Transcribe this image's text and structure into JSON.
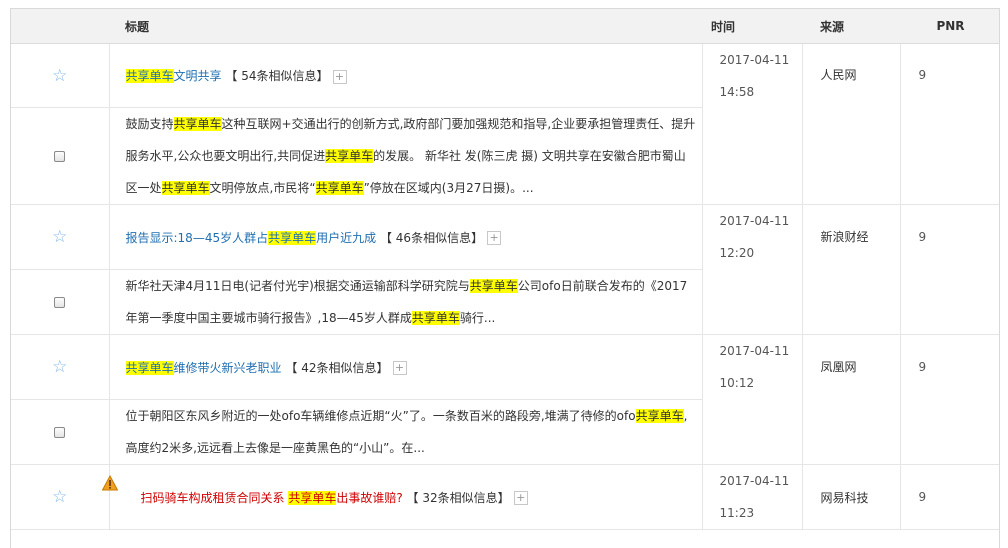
{
  "header": {
    "col_title": "标题",
    "col_time": "时间",
    "col_source": "来源",
    "col_pnr": "PNR"
  },
  "similar_open": "【",
  "similar_close": "】",
  "plus_glyph": "+",
  "star_glyph": "☆",
  "rows": [
    {
      "title_parts": [
        "共享单车",
        "文明共享"
      ],
      "similar": "54条相似信息",
      "date": "2017-04-11",
      "time": "14:58",
      "source": "人民网",
      "pnr": "9",
      "snippet_parts": [
        "鼓励支持",
        "共享单车",
        "这种互联网+交通出行的创新方式,政府部门要加强规范和指导,企业要承担管理责任、提升服务水平,公众也要文明出行,共同促进",
        "共享单车",
        "的发展。 新华社 发(陈三虎 摄) 文明共享在安徽合肥市蜀山区一处",
        "共享单车",
        "文明停放点,市民将“",
        "共享单车",
        "”停放在区域内(3月27日摄)。..."
      ]
    },
    {
      "title_parts": [
        "报告显示:18—45岁人群占",
        "共享单车",
        "用户近九成"
      ],
      "similar": "46条相似信息",
      "date": "2017-04-11",
      "time": "12:20",
      "source": "新浪财经",
      "pnr": "9",
      "snippet_parts": [
        "新华社天津4月11日电(记者付光宇)根据交通运输部科学研究院与",
        "共享单车",
        "公司ofo日前联合发布的《2017年第一季度中国主要城市骑行报告》,18—45岁人群成",
        "共享单车",
        "骑行..."
      ]
    },
    {
      "title_parts": [
        "共享单车",
        "维修带火新兴老职业"
      ],
      "similar": "42条相似信息",
      "date": "2017-04-11",
      "time": "10:12",
      "source": "凤凰网",
      "pnr": "9",
      "snippet_parts": [
        "位于朝阳区东风乡附近的一处ofo车辆维修点近期“火”了。一条数百米的路段旁,堆满了待修的ofo",
        "共享单车",
        ",高度约2米多,远远看上去像是一座黄黑色的“小山”。在..."
      ]
    },
    {
      "title_parts": [
        "扫码骑车构成租赁合同关系 ",
        "共享单车",
        "出事故谁赔?"
      ],
      "similar": "32条相似信息",
      "date": "2017-04-11",
      "time": "11:23",
      "source": "网易科技",
      "pnr": "9"
    }
  ],
  "colors": {
    "highlight": "#ffff00",
    "link": "#1f6fb2",
    "alert_link": "#d00000",
    "header_bg": "#f2f2f2"
  },
  "icons": {
    "favorite": "star-outline-icon",
    "select": "checkbox-icon",
    "expand": "plus-box-icon",
    "alert": "warning-triangle-icon"
  }
}
